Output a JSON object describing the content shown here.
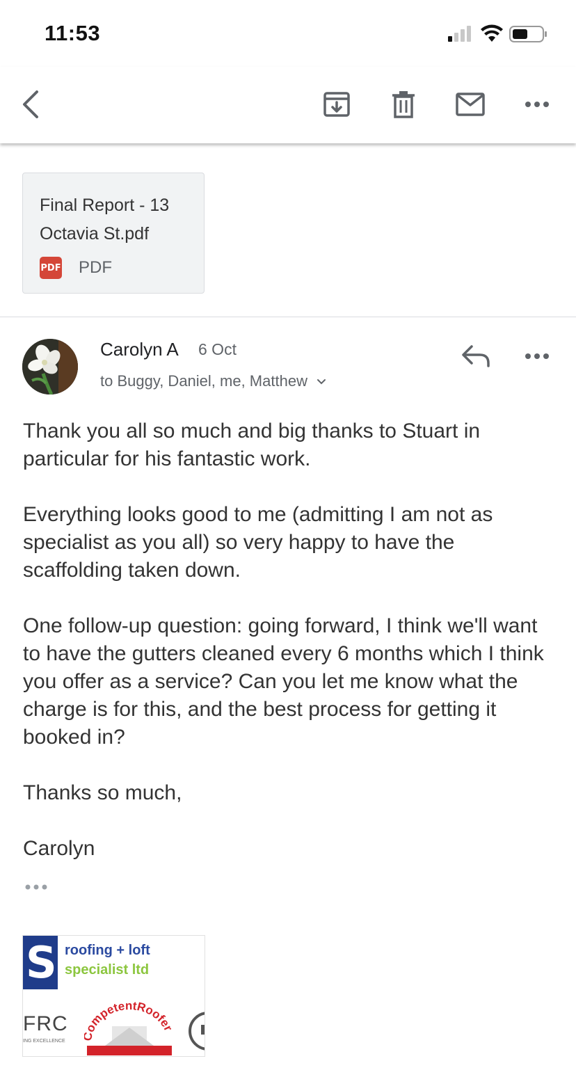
{
  "status_bar": {
    "time": "11:53"
  },
  "toolbar": {
    "back": "back-arrow",
    "archive": "archive-icon",
    "delete": "trash-icon",
    "mark_unread": "mail-icon",
    "more": "more-horiz-icon"
  },
  "attachment": {
    "name": "Final Report - 13 Octavia St.pdf",
    "badge": "PDF",
    "type": "PDF"
  },
  "message": {
    "sender": "Carolyn A",
    "date": "6 Oct",
    "recipients": "to Buggy, Daniel, me, Matthew",
    "paragraphs": [
      "Thank you all so much and big thanks to Stuart in particular for his fantastic work.",
      "Everything looks good to me (admitting I am not as specialist as you all) so very happy to have the scaffolding taken down.",
      "One follow-up question: going forward, I think we'll want to have the gutters cleaned every 6 months which I think you offer as a service? Can you let me know what the charge is for this, and the best process for getting it booked in?",
      "Thanks so much,",
      "Carolyn"
    ]
  },
  "signature": {
    "logo_letter": "S",
    "line1": "roofing + loft",
    "line2": "specialist ltd",
    "frc": "FRC",
    "frc_sub": "ING EXCELLENCE",
    "badge_text": "CompetentRoofer"
  }
}
